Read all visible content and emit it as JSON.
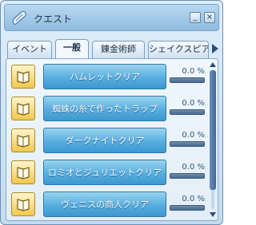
{
  "window": {
    "title": "クエスト",
    "minimize_glyph": "_",
    "close_glyph": "×"
  },
  "icons": {
    "title": "quest-scroll-icon",
    "row": "quest-book-icon",
    "tab_next": "triangle-right-icon"
  },
  "tabs": [
    {
      "label": "イベント",
      "active": false
    },
    {
      "label": "一般",
      "active": true
    },
    {
      "label": "錬金術師",
      "active": false
    },
    {
      "label": "シェイクスピア",
      "active": false
    }
  ],
  "quests": [
    {
      "name": "ハムレットクリア",
      "progress_text": "0.0 %",
      "progress": 0.0
    },
    {
      "name": "蜘蛛の糸で作ったトラップ",
      "progress_text": "0.0 %",
      "progress": 0.0
    },
    {
      "name": "ダークナイトクリア",
      "progress_text": "0.0 %",
      "progress": 0.0
    },
    {
      "name": "ロミオとジュリエットクリア",
      "progress_text": "0.0 %",
      "progress": 0.0
    },
    {
      "name": "ヴェニスの商人クリア",
      "progress_text": "0.0 %",
      "progress": 0.0
    }
  ],
  "colors": {
    "quest_button": "#57aee0",
    "window_bg": "#cfe3f4",
    "scroll_thumb": "#3f6797"
  }
}
